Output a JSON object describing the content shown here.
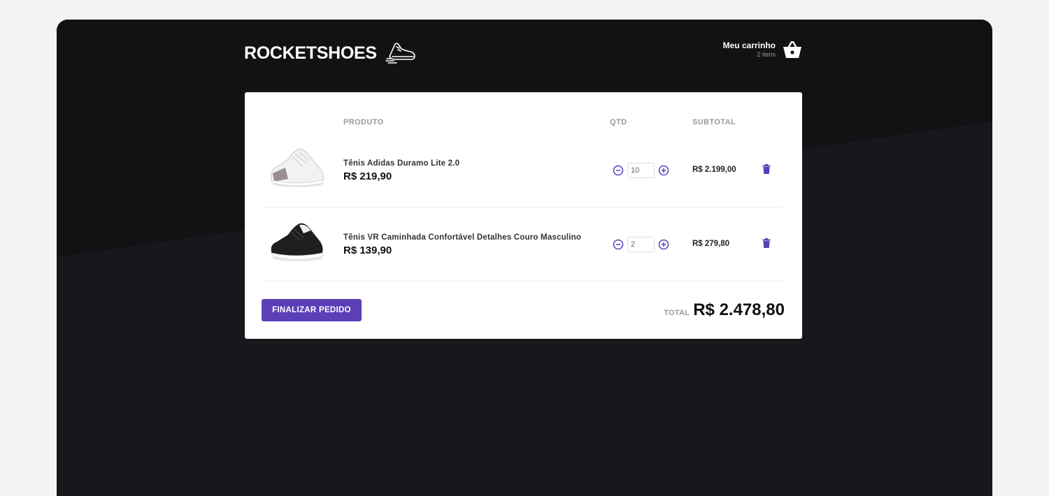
{
  "header": {
    "logo_text": "ROCKETSHOES",
    "cart_title": "Meu carrinho",
    "cart_count": "2 itens"
  },
  "table": {
    "col_product": "PRODUTO",
    "col_qty": "QTD",
    "col_subtotal": "SUBTOTAL"
  },
  "items": [
    {
      "title": "Tênis Adidas Duramo Lite 2.0",
      "price": "R$ 219,90",
      "quantity": "10",
      "subtotal": "R$ 2.199,00",
      "shoe_color": "white"
    },
    {
      "title": "Tênis VR Caminhada Confortável Detalhes Couro Masculino",
      "price": "R$ 139,90",
      "quantity": "2",
      "subtotal": "R$ 279,80",
      "shoe_color": "black"
    }
  ],
  "footer": {
    "checkout_label": "FINALIZAR PEDIDO",
    "total_label": "TOTAL",
    "total_value": "R$ 2.478,80"
  },
  "colors": {
    "accent": "#5b3fb8",
    "background": "#141419",
    "card": "#ffffff"
  }
}
